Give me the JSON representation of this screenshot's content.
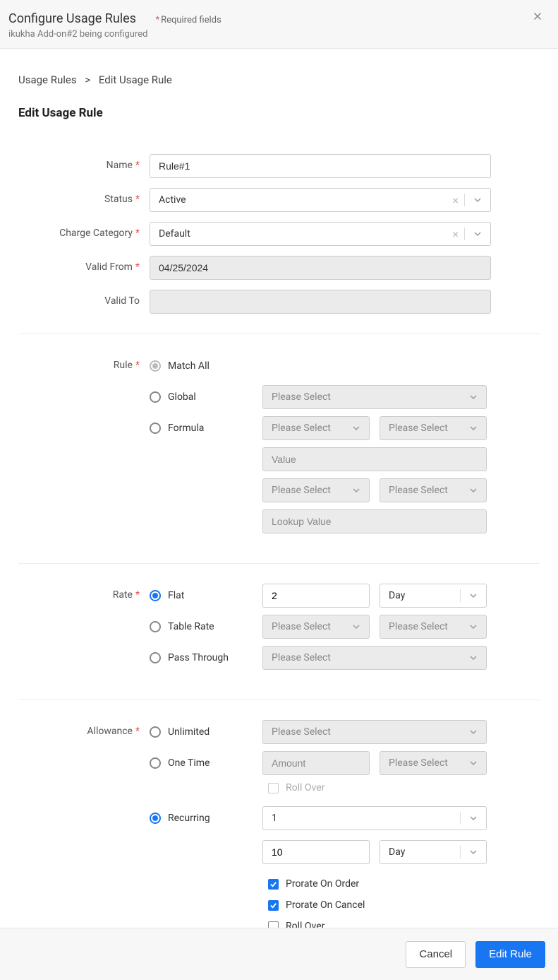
{
  "header": {
    "title": "Configure Usage Rules",
    "required_hint": "Required fields",
    "subtitle": "ikukha Add-on#2 being configured"
  },
  "breadcrumb": {
    "root": "Usage Rules",
    "current": "Edit Usage Rule"
  },
  "page_title": "Edit Usage Rule",
  "labels": {
    "name": "Name",
    "status": "Status",
    "charge_category": "Charge Category",
    "valid_from": "Valid From",
    "valid_to": "Valid To",
    "rule": "Rule",
    "rate": "Rate",
    "allowance": "Allowance"
  },
  "placeholders": {
    "please_select": "Please Select",
    "value": "Value",
    "lookup_value": "Lookup Value",
    "amount": "Amount"
  },
  "form": {
    "name": "Rule#1",
    "status": "Active",
    "charge_category": "Default",
    "valid_from": "04/25/2024",
    "valid_to": ""
  },
  "rule": {
    "options": {
      "match_all": "Match All",
      "global": "Global",
      "formula": "Formula"
    },
    "selected": "match_all"
  },
  "rate": {
    "options": {
      "flat": "Flat",
      "table_rate": "Table Rate",
      "pass_through": "Pass Through"
    },
    "selected": "flat",
    "flat_value": "2",
    "flat_unit": "Day"
  },
  "allowance": {
    "options": {
      "unlimited": "Unlimited",
      "one_time": "One Time",
      "recurring": "Recurring"
    },
    "selected": "recurring",
    "rollover_label": "Roll Over",
    "recurring_qty": "1",
    "recurring_amount": "10",
    "recurring_unit": "Day",
    "prorate_order_label": "Prorate On Order",
    "prorate_cancel_label": "Prorate On Cancel",
    "prorate_order": true,
    "prorate_cancel": true,
    "rollover": false
  },
  "footer": {
    "cancel": "Cancel",
    "submit": "Edit Rule"
  }
}
